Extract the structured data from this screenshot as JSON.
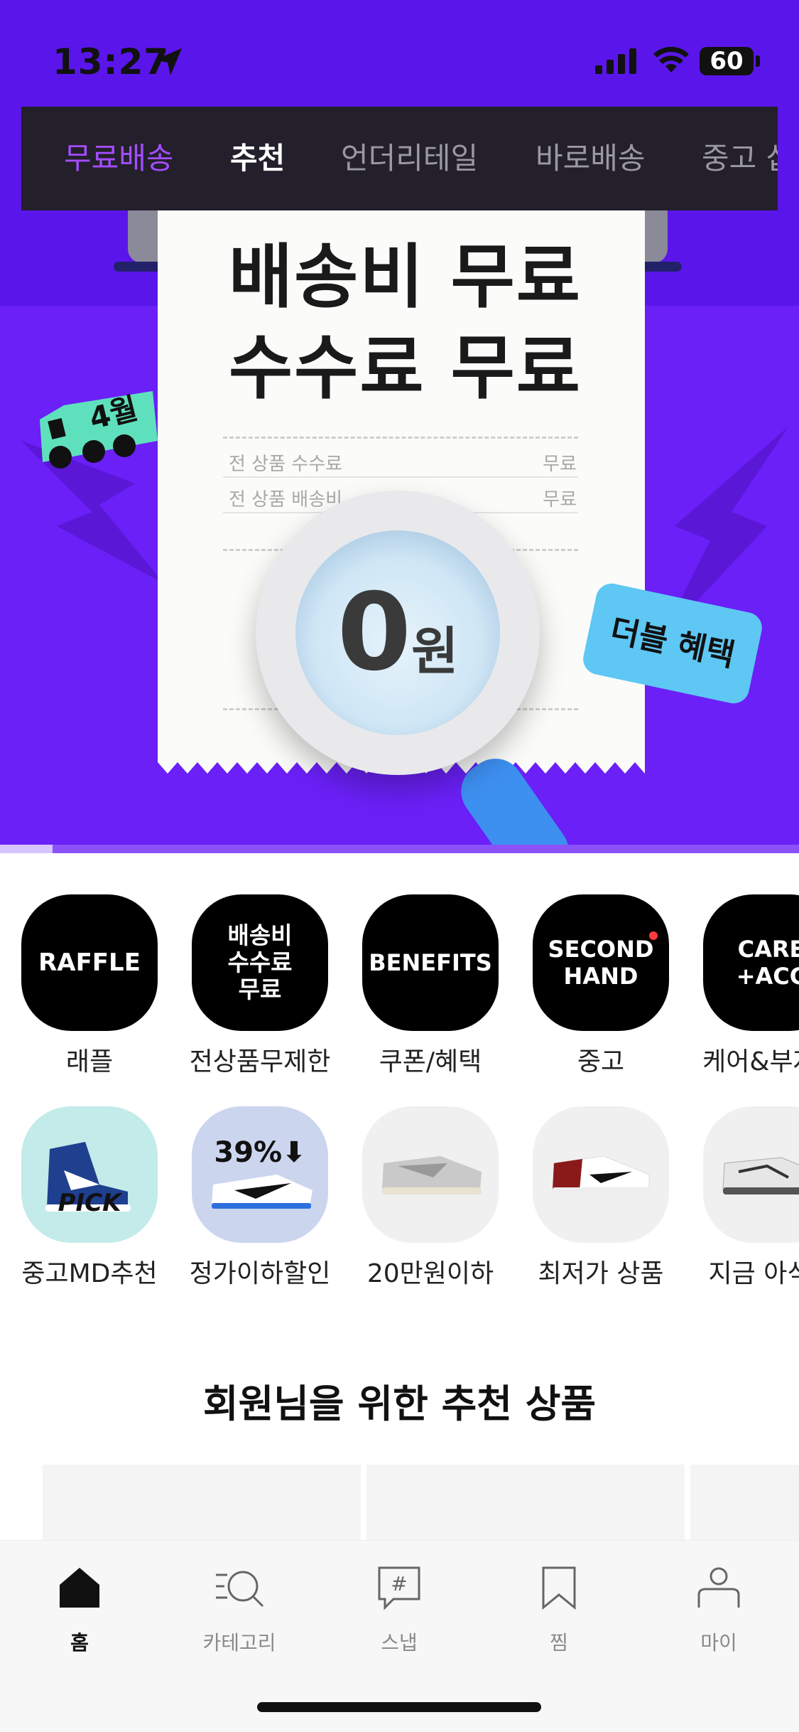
{
  "status_bar": {
    "time": "13:27",
    "battery": "60",
    "icons": [
      "location-arrow-icon",
      "cellular-signal-icon",
      "wifi-icon",
      "battery-icon"
    ]
  },
  "top_tabs": [
    "무료배송",
    "추천",
    "언더리테일",
    "바로배송",
    "중고 샵"
  ],
  "top_tabs_active": [
    "무료배송",
    "추천"
  ],
  "banner": {
    "title_line1": "배송비 무료",
    "title_line2": "수수료 무료",
    "rows": [
      {
        "label": "전 상품 수수료",
        "value": "무료"
      },
      {
        "label": "전 상품 배송비",
        "value": "무료"
      }
    ],
    "amount": "0",
    "amount_unit": "원",
    "truck_label": "4월",
    "coupon_label": "더블 혜택",
    "progress": 0.066
  },
  "category_circles": [
    {
      "text": "RAFFLE",
      "label": "래플"
    },
    {
      "text": "배송비\n수수료\n무료",
      "label": "전상품무제한"
    },
    {
      "text": "BENEFITS",
      "label": "쿠폰/혜택"
    },
    {
      "text": "SECOND\nHAND",
      "label": "중고"
    },
    {
      "text": "CARE\n+ACC",
      "label": "케어&부자재"
    }
  ],
  "shortcut_items": [
    {
      "label": "중고MD추천",
      "overlay": "PICK",
      "bg": "#c2ebe9"
    },
    {
      "label": "정가이하할인",
      "overlay": "39%⬇",
      "bg": "#cbd5ee"
    },
    {
      "label": "20만원이하",
      "overlay": "",
      "bg": "#f0f0f0"
    },
    {
      "label": "최저가 상품",
      "overlay": "",
      "bg": "#f0f0f0"
    },
    {
      "label": "지금 아식스",
      "overlay": "",
      "bg": "#f0f0f0"
    }
  ],
  "section": {
    "title": "회원님을 위한 추천 상품"
  },
  "bottom_nav": [
    {
      "label": "홈",
      "icon": "home-icon",
      "active": true
    },
    {
      "label": "카테고리",
      "icon": "category-search-icon",
      "active": false
    },
    {
      "label": "스냅",
      "icon": "hashtag-chat-icon",
      "active": false
    },
    {
      "label": "찜",
      "icon": "bookmark-icon",
      "active": false
    },
    {
      "label": "마이",
      "icon": "person-icon",
      "active": false
    }
  ],
  "colors": {
    "hero_bg": "#6a20f7",
    "tab_active": "#a34dff",
    "tab_bar_bg": "#231f2b",
    "coupon": "#5ec7f4",
    "truck": "#5fe0bd"
  }
}
